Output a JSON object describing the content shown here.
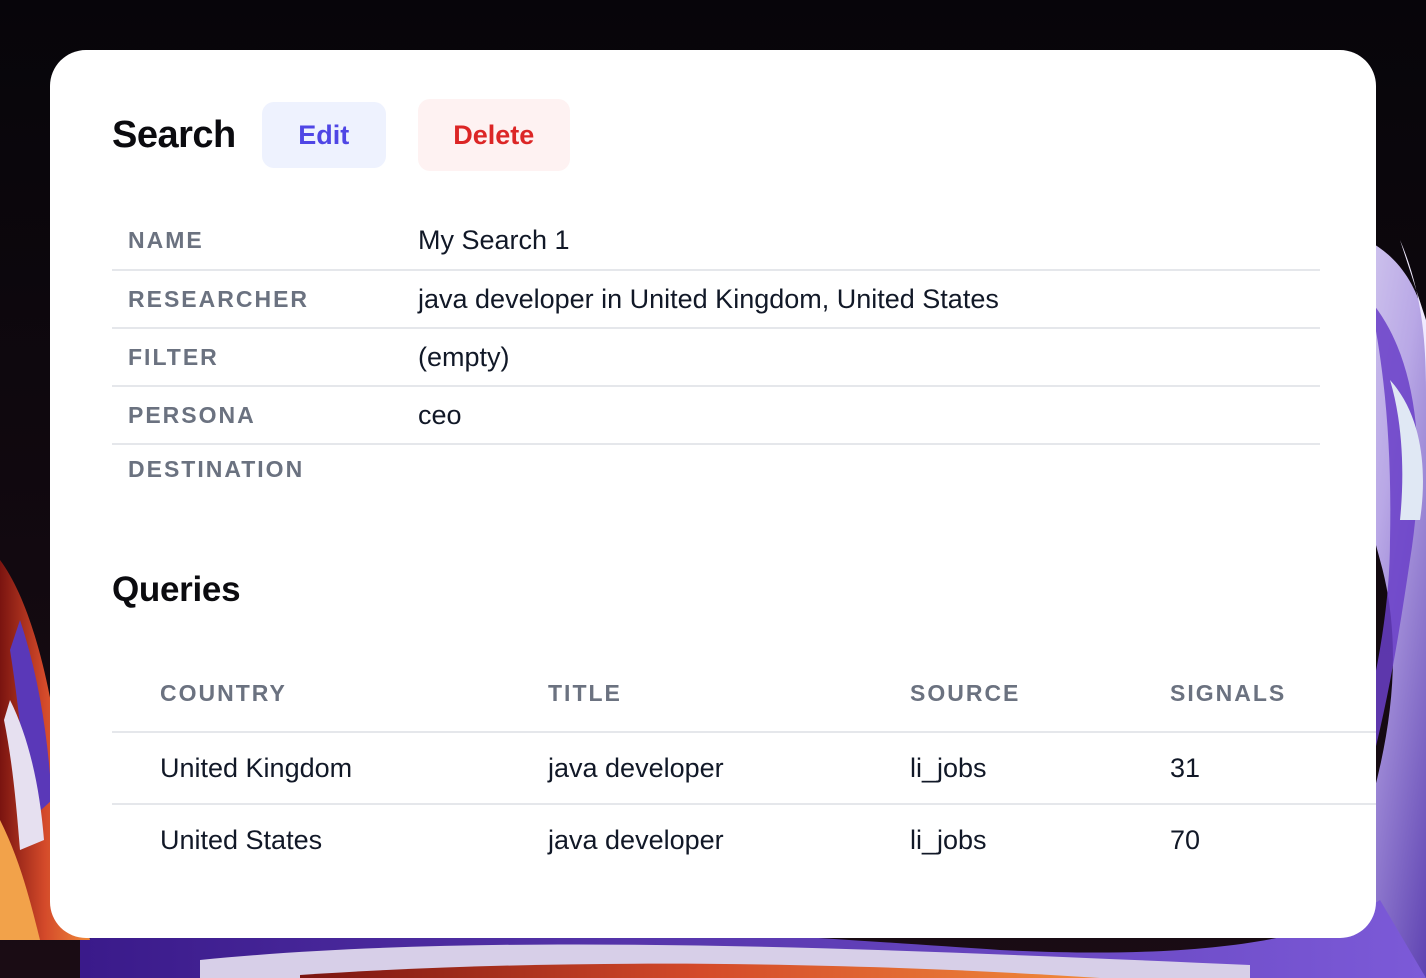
{
  "header": {
    "title": "Search",
    "edit_label": "Edit",
    "delete_label": "Delete"
  },
  "details": [
    {
      "label": "NAME",
      "value": "My Search 1"
    },
    {
      "label": "RESEARCHER",
      "value": "java developer in United Kingdom, United States"
    },
    {
      "label": "FILTER",
      "value": "(empty)"
    },
    {
      "label": "PERSONA",
      "value": "ceo"
    },
    {
      "label": "DESTINATION",
      "value": ""
    }
  ],
  "queries": {
    "title": "Queries",
    "columns": [
      "COUNTRY",
      "TITLE",
      "SOURCE",
      "SIGNALS"
    ],
    "rows": [
      [
        "United Kingdom",
        "java developer",
        "li_jobs",
        "31"
      ],
      [
        "United States",
        "java developer",
        "li_jobs",
        "70"
      ]
    ]
  },
  "colors": {
    "edit_bg": "#eef2fe",
    "edit_text": "#4f46e5",
    "delete_bg": "#fef2f2",
    "delete_text": "#dc2626",
    "label_text": "#6b7280"
  }
}
